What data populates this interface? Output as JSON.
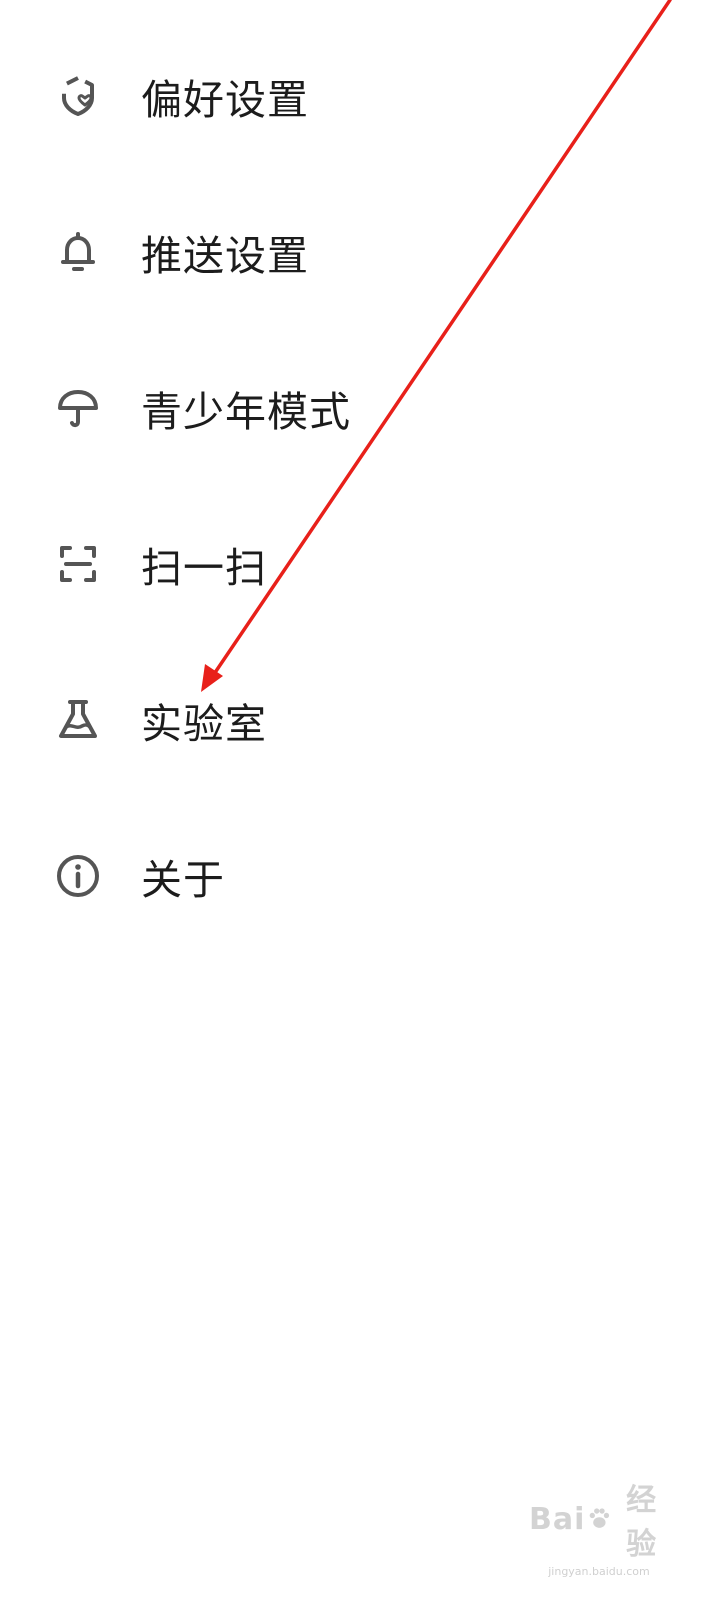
{
  "menu": {
    "items": [
      {
        "label": "偏好设置",
        "icon": "preference-shield-heart-icon"
      },
      {
        "label": "推送设置",
        "icon": "bell-icon"
      },
      {
        "label": "青少年模式",
        "icon": "umbrella-icon"
      },
      {
        "label": "扫一扫",
        "icon": "scan-icon"
      },
      {
        "label": "实验室",
        "icon": "flask-icon"
      },
      {
        "label": "关于",
        "icon": "info-icon"
      }
    ]
  },
  "annotation": {
    "arrow_color": "#e8201a"
  },
  "watermark": {
    "main_left": "Bai",
    "main_right": "经验",
    "sub": "jingyan.baidu.com"
  },
  "colors": {
    "icon": "#555555",
    "text": "#1c1c1c",
    "background": "#ffffff"
  }
}
